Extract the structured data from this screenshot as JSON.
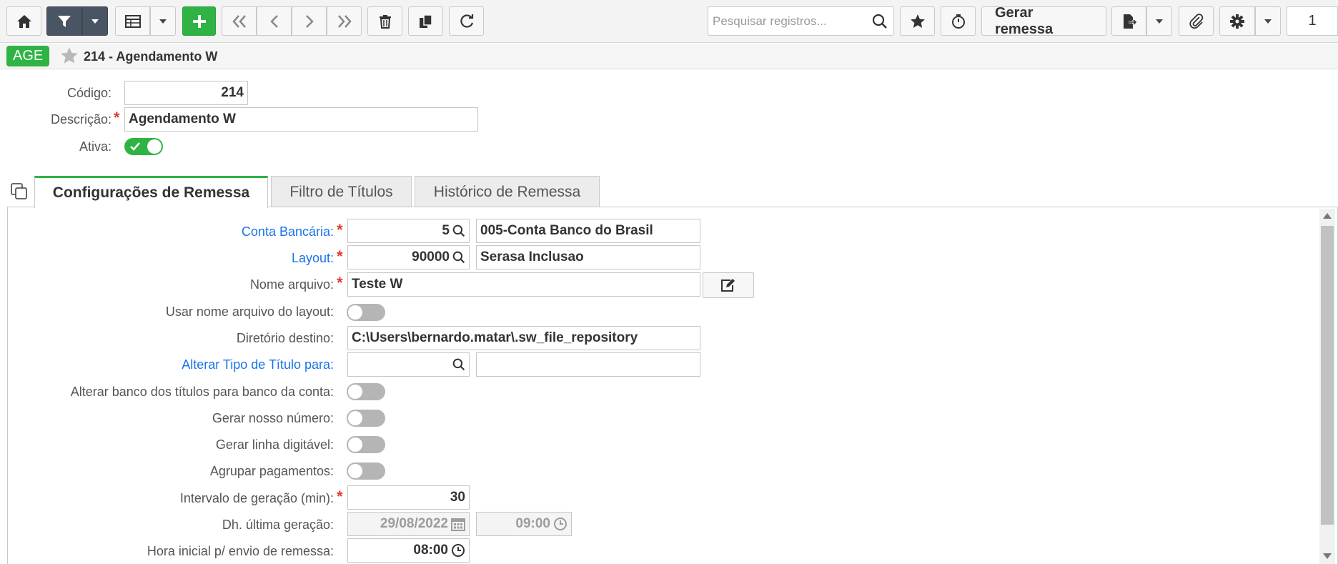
{
  "toolbar": {
    "search_placeholder": "Pesquisar registros...",
    "generate_label": "Gerar remessa",
    "page_number": "1"
  },
  "header": {
    "badge": "AGE",
    "title": "214 - Agendamento W"
  },
  "form": {
    "codigo_label": "Código:",
    "codigo_value": "214",
    "descricao_label": "Descrição:",
    "descricao_value": "Agendamento W",
    "ativa_label": "Ativa:"
  },
  "tabs": [
    {
      "label": "Configurações de Remessa"
    },
    {
      "label": "Filtro de Títulos"
    },
    {
      "label": "Histórico de Remessa"
    }
  ],
  "config": {
    "conta_label": "Conta Bancária:",
    "conta_code": "5",
    "conta_desc": "005-Conta Banco do Brasil",
    "layout_label": "Layout:",
    "layout_code": "90000",
    "layout_desc": "Serasa Inclusao",
    "nome_label": "Nome arquivo:",
    "nome_value": "Teste W",
    "usar_nome_label": "Usar nome arquivo do layout:",
    "diretorio_label": "Diretório destino:",
    "diretorio_value": "C:\\Users\\bernardo.matar\\.sw_file_repository",
    "alterar_tipo_label": "Alterar Tipo de Título para:",
    "alterar_banco_label": "Alterar banco dos títulos para banco da conta:",
    "nosso_numero_label": "Gerar nosso número:",
    "linha_digitavel_label": "Gerar linha digitável:",
    "agrupar_label": "Agrupar pagamentos:",
    "intervalo_label": "Intervalo de geração (min):",
    "intervalo_value": "30",
    "dh_label": "Dh. última geração:",
    "dh_date": "29/08/2022",
    "dh_time": "09:00",
    "hora_label": "Hora inicial p/ envio de remessa:",
    "hora_value": "08:00"
  },
  "colors": {
    "accent_green": "#2fb344",
    "link_blue": "#1a73e8",
    "required_red": "#e53935",
    "toolbar_dark": "#4a5563"
  }
}
